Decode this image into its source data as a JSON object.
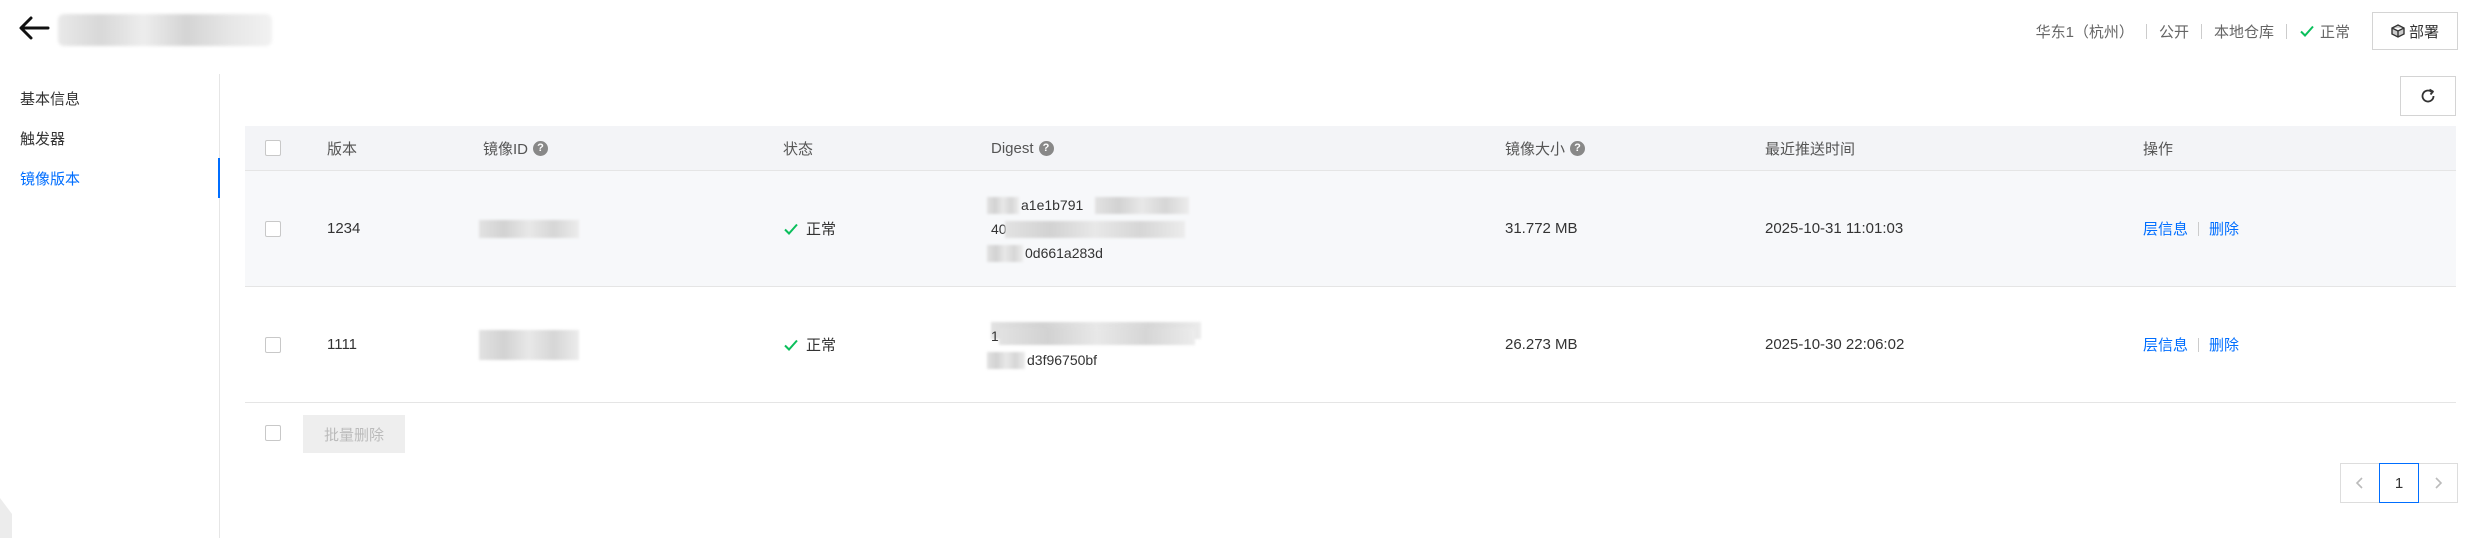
{
  "header": {
    "title": "",
    "region": "华东1（杭州）",
    "visibility": "公开",
    "repo_type": "本地仓库",
    "status": "正常",
    "deploy_label": "部署"
  },
  "sidebar": {
    "items": [
      {
        "label": "基本信息"
      },
      {
        "label": "触发器"
      },
      {
        "label": "镜像版本"
      }
    ]
  },
  "table": {
    "headers": {
      "version": "版本",
      "image_id": "镜像ID",
      "status": "状态",
      "digest": "Digest",
      "size": "镜像大小",
      "pushed_at": "最近推送时间",
      "actions": "操作"
    },
    "rows": [
      {
        "version": "1234",
        "image_id": "",
        "status": "正常",
        "digest_lines": [
          "a1e1b791",
          "40",
          "0d661a283d"
        ],
        "size": "31.772 MB",
        "pushed_at": "2025-10-31 11:01:03",
        "layer_info": "层信息",
        "delete": "删除"
      },
      {
        "version": "1111",
        "image_id": "",
        "status": "正常",
        "digest_lines": [
          "",
          "1",
          "d3f96750bf"
        ],
        "size": "26.273 MB",
        "pushed_at": "2025-10-30 22:06:02",
        "layer_info": "层信息",
        "delete": "删除"
      }
    ]
  },
  "footer": {
    "bulk_delete_label": "批量删除"
  },
  "pagination": {
    "current_page": "1"
  },
  "colors": {
    "accent": "#006eff",
    "success": "#0abf5b"
  }
}
